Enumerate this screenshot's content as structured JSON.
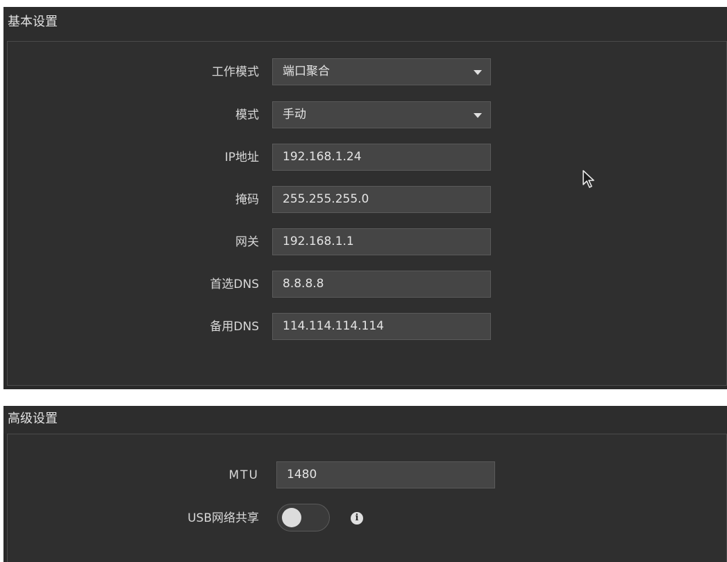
{
  "basic": {
    "title": "基本设置",
    "work_mode": {
      "label": "工作模式",
      "value": "端口聚合"
    },
    "mode": {
      "label": "模式",
      "value": "手动"
    },
    "ip": {
      "label": "IP地址",
      "value": "192.168.1.24"
    },
    "mask": {
      "label": "掩码",
      "value": "255.255.255.0"
    },
    "gateway": {
      "label": "网关",
      "value": "192.168.1.1"
    },
    "dns1": {
      "label": "首选DNS",
      "value": "8.8.8.8"
    },
    "dns2": {
      "label": "备用DNS",
      "value": "114.114.114.114"
    }
  },
  "advanced": {
    "title": "高级设置",
    "mtu": {
      "label": "MTU",
      "value": "1480"
    },
    "usb_share": {
      "label": "USB网络共享",
      "enabled": false
    }
  },
  "icons": {
    "dropdown": "caret-down-icon",
    "info": "info-icon",
    "cursor": "mouse-cursor-icon"
  },
  "colors": {
    "panel_bg": "#2f2f2f",
    "field_bg": "#454545",
    "text": "#d8d8d8"
  }
}
